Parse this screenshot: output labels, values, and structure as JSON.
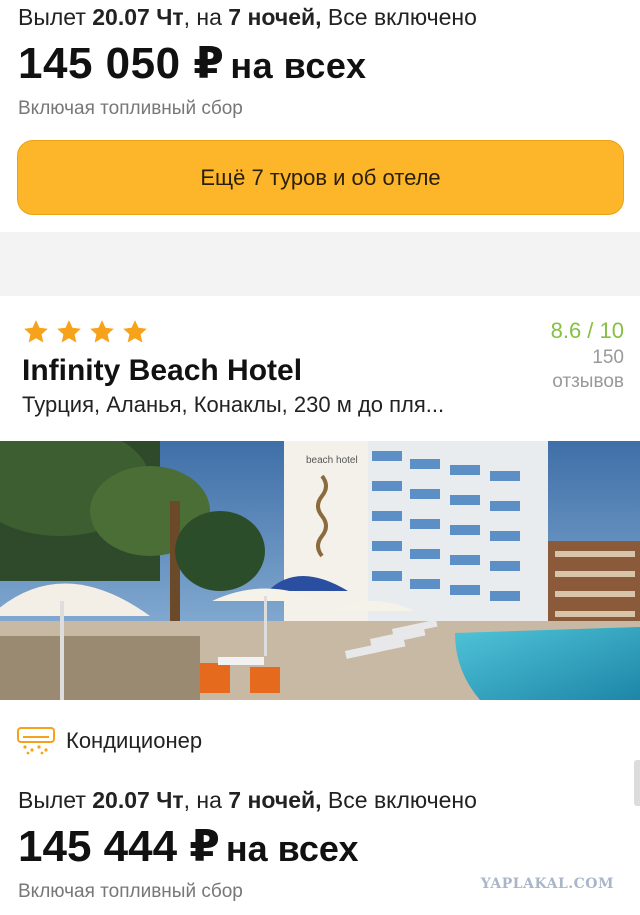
{
  "tour1": {
    "depart_prefix": "Вылет ",
    "date": "20.07 Чт",
    "mid": ", на ",
    "nights": "7 ночей",
    "sep": ",",
    "meal": " Все включено",
    "price": "145 050 ₽",
    "price_suffix": "на всех",
    "fuel_note": "Включая топливный сбор"
  },
  "more_button": {
    "label": "Ещё 7 туров и об отеле"
  },
  "hotel": {
    "stars": 4,
    "name": "Infinity Beach Hotel",
    "location": "Турция, Аланья, Конаклы, 230 м до пля...",
    "rating": "8.6 / 10",
    "reviews_count": "150",
    "reviews_label": "отзывов",
    "photo_sign": "beach hotel"
  },
  "amenity": {
    "icon": "air-conditioner-icon",
    "label": "Кондиционер"
  },
  "tour2": {
    "depart_prefix": "Вылет ",
    "date": "20.07 Чт",
    "mid": ", на ",
    "nights": "7 ночей",
    "sep": ",",
    "meal": " Все включено",
    "price": "145 444 ₽",
    "price_suffix": "на всех",
    "fuel_note": "Включая топливный сбор"
  },
  "watermark": "YAPLAKAL.COM",
  "colors": {
    "accent_button": "#fdb529",
    "star": "#f7a21b",
    "rating": "#85c046"
  }
}
